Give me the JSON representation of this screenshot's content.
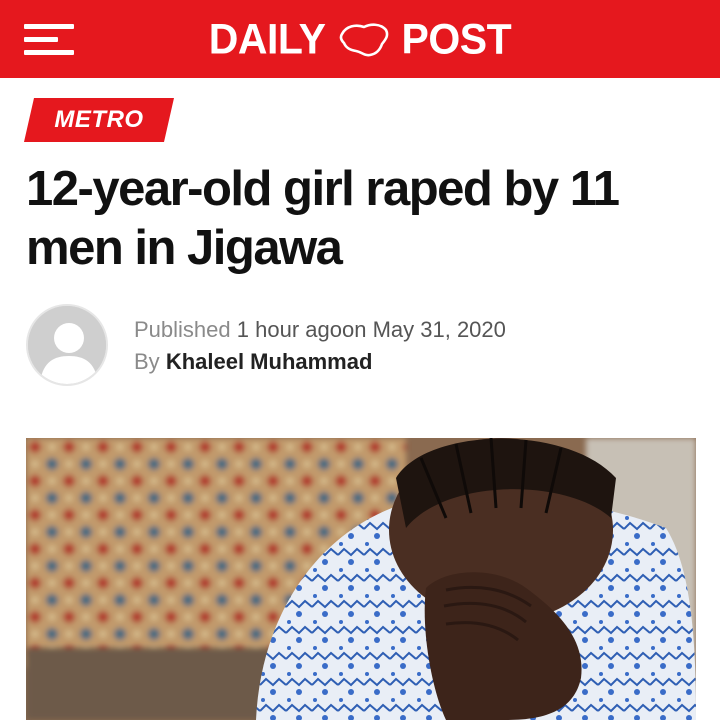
{
  "header": {
    "brand_left": "DAILY",
    "brand_right": "POST",
    "menu_icon": "hamburger-icon",
    "logo_icon": "nigeria-map-icon",
    "brand_color": "#e5181e"
  },
  "article": {
    "category": "METRO",
    "headline": "12-year-old girl raped by 11 men in Jigawa",
    "published_label": "Published",
    "published_relative": "1 hour ago",
    "published_on": "on",
    "published_date": "May 31, 2020",
    "by_label": "By",
    "author": "Khaleel Muhammad",
    "avatar_icon": "default-user-avatar-icon",
    "image_description": "photo"
  }
}
